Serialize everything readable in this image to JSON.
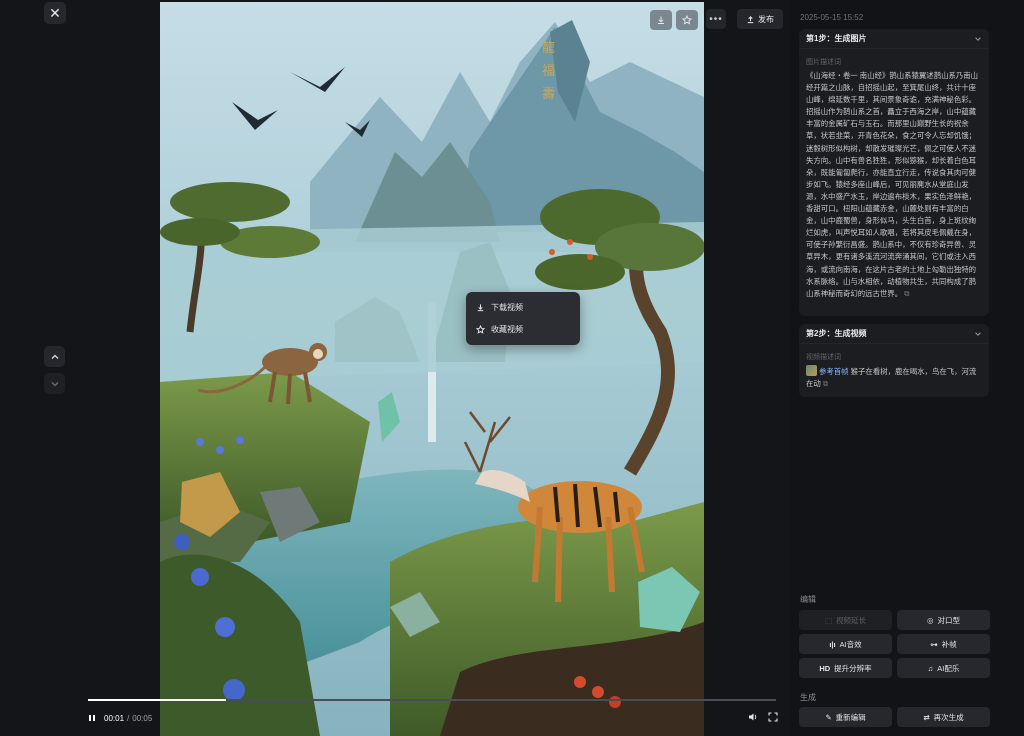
{
  "viewer": {
    "publish_label": "发布",
    "menu": [
      {
        "label": "下载视频",
        "icon": "download-icon"
      },
      {
        "label": "收藏视频",
        "icon": "star-icon"
      }
    ],
    "player": {
      "current_time": "00:01",
      "separator": "/",
      "total_time": "00:05",
      "progress": 0.2
    },
    "image_calligraphy": [
      "龍",
      "福",
      "壽"
    ]
  },
  "panel": {
    "date": "2025-05-15 15:52",
    "step1": {
      "title": "第1步：生成图片",
      "sub_label": "图片描述词",
      "text": "《山海经・卷一 南山经》鹊山系猿翼述鹊山系乃南山经开篇之山脉，自招摇山起，至箕尾山终，共计十座山峰，绵延数千里，其间景象奇诡，充满神秘色彩。招摇山作为鹊山系之首，矗立于西海之岸，山中蕴藏丰富的金属矿石与玉石。而那里山巅野生长的祝余草，状若韭菜，开青色花朵，食之可令人忘却饥饿；迷縠树形似构树，却散发璀璨光芒，佩之可使人不迷失方向。山中有兽名狌狌，形似猕猴，却长着白色耳朵，既能匍匐爬行，亦能直立行走，传说食其肉可健步如飞。猿经多座山峰后，可见丽麂水从堂庭山发源，水中盛产水玉，岸边遍布棪木，果实色泽鲜艳，香甜可口。杻阳山蕴藏赤金，山麓处则有丰富的白金，山中鹿蜀兽，身形似马，头生白首，身上斑纹绚烂如虎，叫声悦耳如人歌唱，若将其皮毛佩戴在身，可使子孙繁衍昌盛。鹊山系中，不仅有珍奇异兽、灵草异木，更有诸多溪流河流奔涌其间，它们或注入西海，或流向南海，在这片古老的土地上勾勒出独特的水系脉络。山与水相依，动植物共生，共同构成了鹊山系神秘而奇幻的远古世界。"
    },
    "step2": {
      "title": "第2步：生成视频",
      "sub_label": "视频描述词",
      "ref_label": "参考首帧",
      "text": "猴子在看树，鹿在喝水，鸟在飞，河流在动"
    },
    "edit_section": {
      "label": "编辑",
      "buttons": [
        {
          "label": "视频延长",
          "icon": "extend-icon",
          "glyph": "⬚",
          "disabled": true
        },
        {
          "label": "对口型",
          "icon": "lip-sync-icon",
          "glyph": "◎",
          "disabled": false
        },
        {
          "label": "AI音效",
          "icon": "sound-effect-icon",
          "glyph": "ı|ı",
          "disabled": false
        },
        {
          "label": "补帧",
          "icon": "frame-interp-icon",
          "glyph": "⊶",
          "disabled": false
        },
        {
          "label": "提升分辨率",
          "icon": "hd-icon",
          "glyph": "HD",
          "disabled": false
        },
        {
          "label": "AI配乐",
          "icon": "music-icon",
          "glyph": "♫",
          "disabled": false
        }
      ]
    },
    "generate_section": {
      "label": "生成",
      "buttons": [
        {
          "label": "重新编辑",
          "icon": "pencil-icon",
          "glyph": "✎"
        },
        {
          "label": "再次生成",
          "icon": "regenerate-icon",
          "glyph": "⇄"
        }
      ]
    }
  }
}
